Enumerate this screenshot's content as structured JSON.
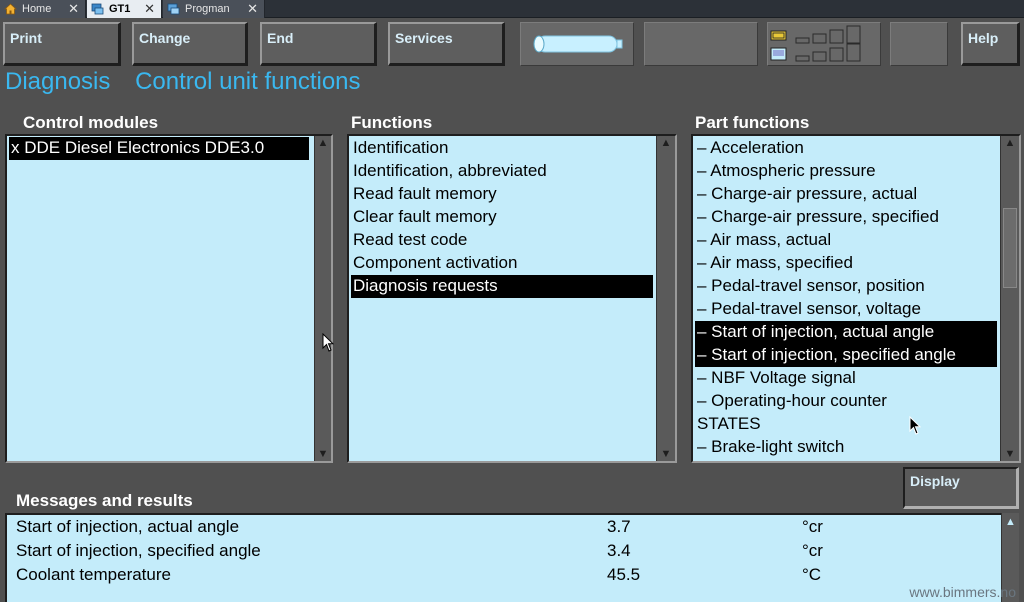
{
  "tabs": [
    {
      "label": "Home",
      "icon": "home-icon"
    },
    {
      "label": "GT1",
      "icon": "gt1-app-icon"
    },
    {
      "label": "Progman",
      "icon": "progman-app-icon"
    }
  ],
  "toolbar": {
    "print": "Print",
    "change": "Change",
    "end": "End",
    "services": "Services",
    "help": "Help"
  },
  "heading": {
    "left": "Diagnosis",
    "right": "Control unit functions"
  },
  "control_modules": {
    "title": "Control modules",
    "items": [
      "x DDE Diesel Electronics DDE3.0"
    ],
    "selected_index": 0
  },
  "functions": {
    "title": "Functions",
    "items": [
      "Identification",
      "Identification, abbreviated",
      "Read fault memory",
      "Clear fault memory",
      "Read test code",
      "Component activation",
      "Diagnosis requests"
    ],
    "selected_index": 6
  },
  "part_functions": {
    "title": "Part functions",
    "items": [
      "– Acceleration",
      "– Atmospheric pressure",
      "– Charge-air pressure, actual",
      "– Charge-air pressure, specified",
      "– Air mass, actual",
      "– Air mass, specified",
      "– Pedal-travel sensor, position",
      "– Pedal-travel sensor, voltage",
      "– Start of injection, actual angle",
      "– Start of injection, specified angle",
      "– NBF Voltage signal",
      "– Operating-hour counter",
      "STATES",
      "– Brake-light switch"
    ],
    "selected_indices": [
      8,
      9
    ]
  },
  "display_button": "Display",
  "messages": {
    "title": "Messages and results",
    "rows": [
      {
        "name": "Start of injection, actual angle",
        "value": "3.7",
        "unit": "°cr"
      },
      {
        "name": "Start of injection, specified angle",
        "value": "3.4",
        "unit": "°cr"
      },
      {
        "name": "Coolant temperature",
        "value": "45.5",
        "unit": "°C"
      }
    ]
  },
  "watermark": "www.bimmers.no",
  "colors": {
    "background": "#505050",
    "list_bg": "#c4ecfa",
    "accent_text": "#3ab8f0",
    "button_text": "#d8eef8",
    "selection": "#000000"
  }
}
